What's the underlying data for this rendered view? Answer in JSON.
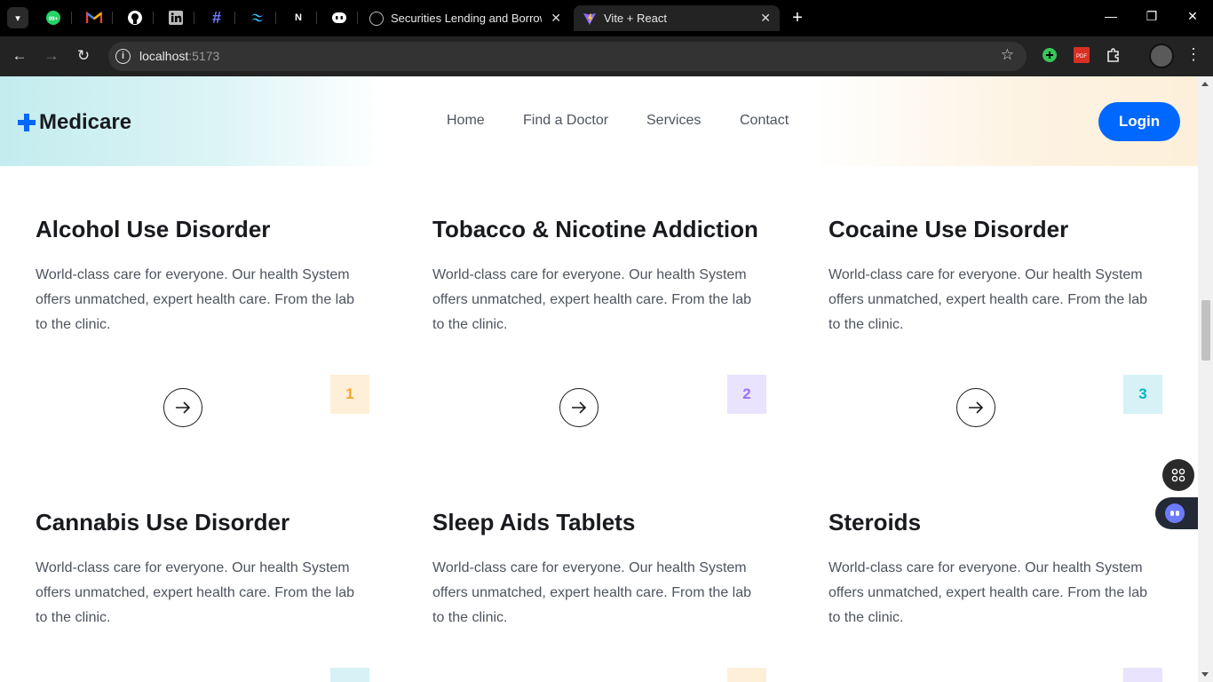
{
  "browser": {
    "tabs": [
      {
        "title": "Securities Lending and Borrowin",
        "active": false
      },
      {
        "title": "Vite + React",
        "active": true
      }
    ],
    "pinned_icons": [
      "whatsapp-icon",
      "gmail-icon",
      "github-icon",
      "linkedin-icon",
      "hashnode-icon",
      "tailwind-icon",
      "nextjs-icon",
      "copilot-icon"
    ],
    "pinned_badge": "99+",
    "address": {
      "host": "localhost",
      "port": ":5173"
    },
    "extensions": [
      "add-extension-icon",
      "pdf-icon",
      "puzzle-icon"
    ]
  },
  "site": {
    "brand": "Medicare",
    "nav": [
      "Home",
      "Find a Doctor",
      "Services",
      "Contact"
    ],
    "login_label": "Login",
    "colors": {
      "primary": "#0067ff",
      "heading": "#181a1e",
      "text": "#4e545f"
    }
  },
  "services": [
    {
      "name": "Alcohol Use Disorder",
      "desc": "World-class care for everyone. Our health System offers unmatched, expert health care. From the lab to the clinic.",
      "number": "1",
      "badge_bg": "#feefd8",
      "badge_fg": "#f5a623"
    },
    {
      "name": "Tobacco & Nicotine Addiction",
      "desc": "World-class care for everyone. Our health System offers unmatched, expert health care. From the lab to the clinic.",
      "number": "2",
      "badge_bg": "#e9e3fd",
      "badge_fg": "#9771fa"
    },
    {
      "name": "Cocaine Use Disorder",
      "desc": "World-class care for everyone. Our health System offers unmatched, expert health care. From the lab to the clinic.",
      "number": "3",
      "badge_bg": "#d6f2f6",
      "badge_fg": "#01b5c5"
    },
    {
      "name": "Cannabis Use Disorder",
      "desc": "World-class care for everyone. Our health System offers unmatched, expert health care. From the lab to the clinic.",
      "number": "",
      "badge_bg": "#d6f2f6",
      "badge_fg": "#01b5c5"
    },
    {
      "name": "Sleep Aids Tablets",
      "desc": "World-class care for everyone. Our health System offers unmatched, expert health care. From the lab to the clinic.",
      "number": "",
      "badge_bg": "#feefd8",
      "badge_fg": "#f5a623"
    },
    {
      "name": "Steroids",
      "desc": "World-class care for everyone. Our health System offers unmatched, expert health care. From the lab to the clinic.",
      "number": "",
      "badge_bg": "#e9e3fd",
      "badge_fg": "#9771fa"
    }
  ]
}
